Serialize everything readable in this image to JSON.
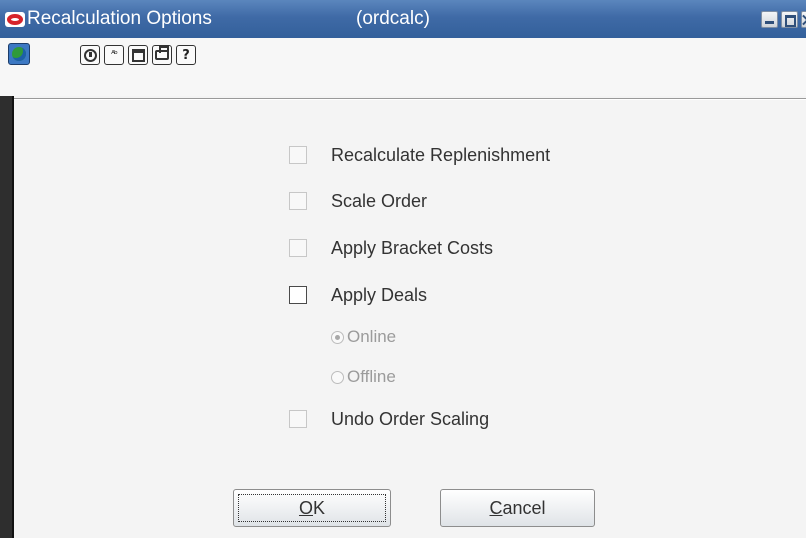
{
  "window": {
    "title": "Recalculation Options",
    "form_name": "(ordcalc)",
    "controls": [
      "minimize-icon",
      "maximize-icon",
      "close-icon"
    ]
  },
  "toolbar": {
    "icons": [
      "globe-icon",
      "navigate-icon",
      "spell-check-icon",
      "calendar-icon",
      "print-icon",
      "help-icon"
    ],
    "abc_glyph": "ᴬᵇ",
    "help_glyph": "?"
  },
  "options": {
    "recalculate_replenishment": {
      "label": "Recalculate Replenishment",
      "checked": false,
      "enabled": false
    },
    "scale_order": {
      "label": "Scale Order",
      "checked": false,
      "enabled": false
    },
    "apply_bracket_costs": {
      "label": "Apply Bracket Costs",
      "checked": false,
      "enabled": false
    },
    "apply_deals": {
      "label": "Apply Deals",
      "checked": false,
      "enabled": true
    },
    "undo_order_scaling": {
      "label": "Undo Order Scaling",
      "checked": false,
      "enabled": false
    }
  },
  "deal_mode": {
    "online": {
      "label": "Online",
      "selected": true,
      "enabled": false
    },
    "offline": {
      "label": "Offline",
      "selected": false,
      "enabled": false
    }
  },
  "buttons": {
    "ok": {
      "mnemonic": "O",
      "rest": "K"
    },
    "cancel": {
      "mnemonic": "C",
      "rest": "ancel"
    }
  },
  "colors": {
    "titlebar": "#3f6aa6",
    "oracle_logo": "#d6232a"
  }
}
